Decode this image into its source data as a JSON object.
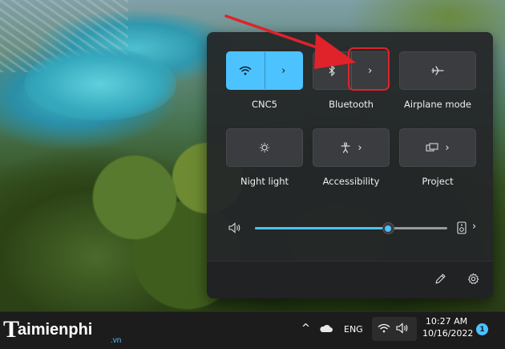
{
  "quick_settings": {
    "tiles": [
      {
        "label": "CNC5",
        "icon": "wifi-icon",
        "state": "on"
      },
      {
        "label": "Bluetooth",
        "icon": "bluetooth-icon",
        "state": "off"
      },
      {
        "label": "Airplane mode",
        "icon": "airplane-icon",
        "state": "off"
      },
      {
        "label": "Night light",
        "icon": "night-light-icon",
        "state": "off"
      },
      {
        "label": "Accessibility",
        "icon": "accessibility-icon",
        "state": "off"
      },
      {
        "label": "Project",
        "icon": "project-icon",
        "state": "off"
      }
    ],
    "chevron": "›",
    "volume": {
      "level": 0.69
    },
    "accent_color": "#4cc2ff",
    "annotation_color": "#e0222a"
  },
  "taskbar": {
    "language": "ENG",
    "time": "10:27 AM",
    "date": "10/16/2022",
    "notification_count": "1",
    "overflow_chevron": "^"
  },
  "watermark": {
    "brand": "aimienphi",
    "brand_initial": "T",
    "suffix": ".vn"
  }
}
